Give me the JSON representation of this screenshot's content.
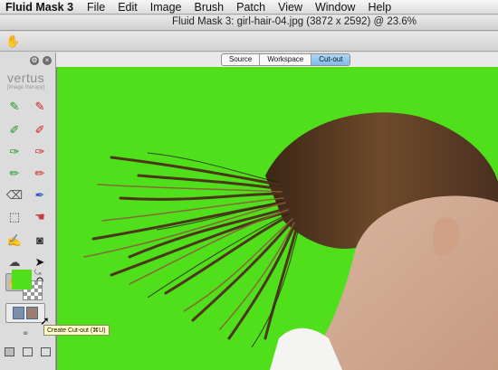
{
  "menubar": {
    "app_name": "Fluid Mask 3",
    "items": [
      "File",
      "Edit",
      "Image",
      "Brush",
      "Patch",
      "View",
      "Window",
      "Help"
    ]
  },
  "window": {
    "title": "Fluid Mask 3: girl-hair-04.jpg (3872 x 2592) @ 23.6%"
  },
  "view_tabs": {
    "items": [
      "Source",
      "Workspace",
      "Cut-out"
    ],
    "active": "Cut-out"
  },
  "panel": {
    "brand": "vertus",
    "brand_sub": "[image therapy]",
    "foreground_color": "#4fe01b",
    "tooltip": "Create Cut-out (⌘U)"
  },
  "colors": {
    "canvas_background": "#4fe01b",
    "active_tab": "#8fc6f1"
  }
}
